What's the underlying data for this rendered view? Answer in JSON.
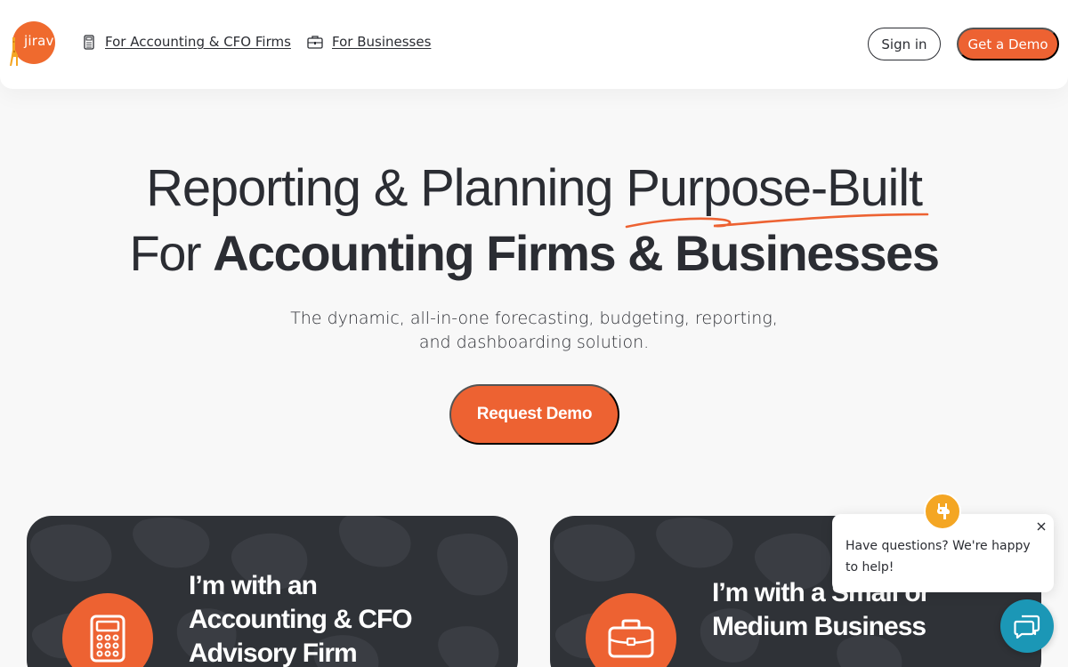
{
  "header": {
    "logo_text": "jirav",
    "nav": [
      {
        "label": "For Accounting & CFO Firms",
        "icon": "calculator-icon"
      },
      {
        "label": "For Businesses",
        "icon": "briefcase-icon"
      }
    ],
    "signin_label": "Sign in",
    "get_demo_label": "Get a Demo"
  },
  "hero": {
    "line1_pre": "Reporting & Planning ",
    "line1_highlight": "Purpose-Built",
    "line2_pre": "For ",
    "line2_bold": "Accounting Firms & Businesses",
    "subtitle": "The dynamic, all-in-one forecasting, budgeting, reporting, and dashboarding solution.",
    "cta_label": "Request Demo"
  },
  "cards": [
    {
      "title": "I’m with an Accounting & CFO Advisory Firm",
      "icon": "calculator-icon"
    },
    {
      "title": "I’m with a Small or Medium Business",
      "icon": "briefcase-icon"
    }
  ],
  "chat": {
    "message": "Have questions? We're happy to help!",
    "avatar_icon": "giraffe-icon",
    "launcher_icon": "chat-icon",
    "close_icon": "close-icon"
  },
  "colors": {
    "accent": "#ED6232",
    "card_bg": "#2F3237",
    "chat_launcher": "#1B97B6",
    "page_bg": "#F8F8F8"
  }
}
